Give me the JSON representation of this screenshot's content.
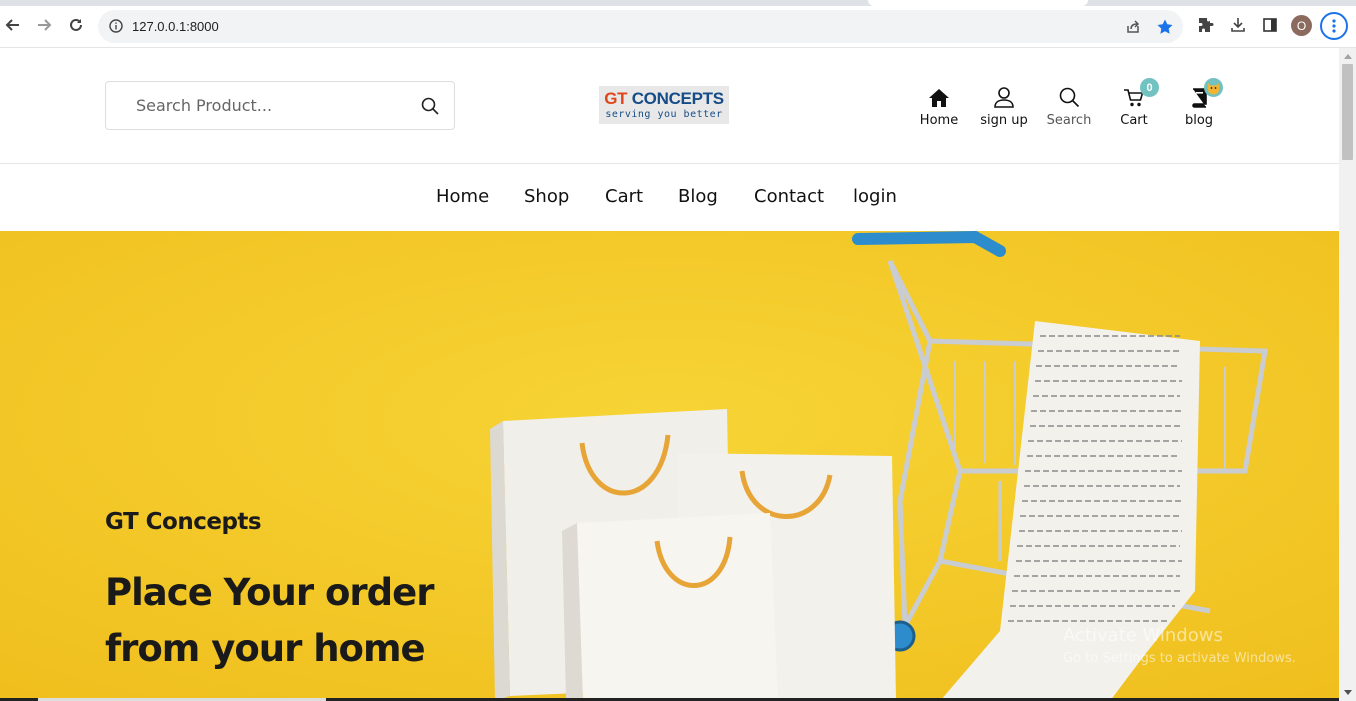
{
  "browser": {
    "url": "127.0.0.1:8000",
    "profile_initial": "O",
    "accent": "#1a73e8"
  },
  "header": {
    "search": {
      "placeholder": "Search Product..."
    },
    "logo": {
      "brand_a": "GT",
      "brand_b": "CONCEPTS",
      "tagline": "serving you better"
    },
    "icons": [
      {
        "label": "Home",
        "icon": "home-icon"
      },
      {
        "label": "sign up",
        "icon": "user-icon"
      },
      {
        "label": "Search",
        "icon": "search-icon"
      },
      {
        "label": "Cart",
        "icon": "cart-icon",
        "badge": "0"
      },
      {
        "label": "blog",
        "icon": "book-icon"
      }
    ],
    "badge_color": "#71c2c0"
  },
  "nav": {
    "items": [
      "Home",
      "Shop",
      "Cart",
      "Blog",
      "Contact",
      "login"
    ]
  },
  "hero": {
    "eyebrow": "GT Concepts",
    "heading_line1": "Place Your order",
    "heading_line2": "from your home",
    "background": "#f4c928"
  },
  "watermark": {
    "title": "Activate Windows",
    "subtitle": "Go to Settings to activate Windows."
  }
}
